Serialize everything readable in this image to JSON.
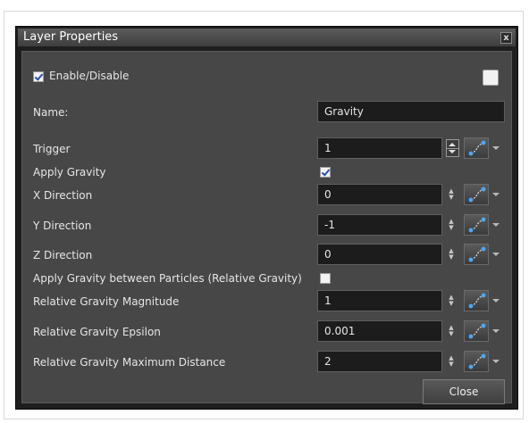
{
  "dialog": {
    "title": "Layer Properties",
    "close_glyph": "x"
  },
  "enable": {
    "label": "Enable/Disable",
    "checked": true
  },
  "name": {
    "label": "Name:",
    "value": "Gravity"
  },
  "rows": [
    {
      "label": "Trigger",
      "value": "1",
      "spinner": true
    },
    {
      "label": "Apply Gravity",
      "checked": true
    },
    {
      "label": "X Direction",
      "value": "0"
    },
    {
      "label": "Y Direction",
      "value": "-1"
    },
    {
      "label": "Z Direction",
      "value": "0"
    },
    {
      "label": "Apply Gravity between Particles (Relative Gravity)",
      "checked": false
    },
    {
      "label": "Relative Gravity Magnitude",
      "value": "1"
    },
    {
      "label": "Relative Gravity Epsilon",
      "value": "0.001"
    },
    {
      "label": "Relative Gravity Maximum Distance",
      "value": "2"
    }
  ],
  "buttons": {
    "close": "Close"
  },
  "icons": {
    "function": "function-curve-icon",
    "dropdown": "chevron-down-icon",
    "spinner": "spinner-arrows-icon"
  },
  "colors": {
    "accent": "#4aa8ff",
    "background": "#474747",
    "field": "#1c1c1c"
  }
}
